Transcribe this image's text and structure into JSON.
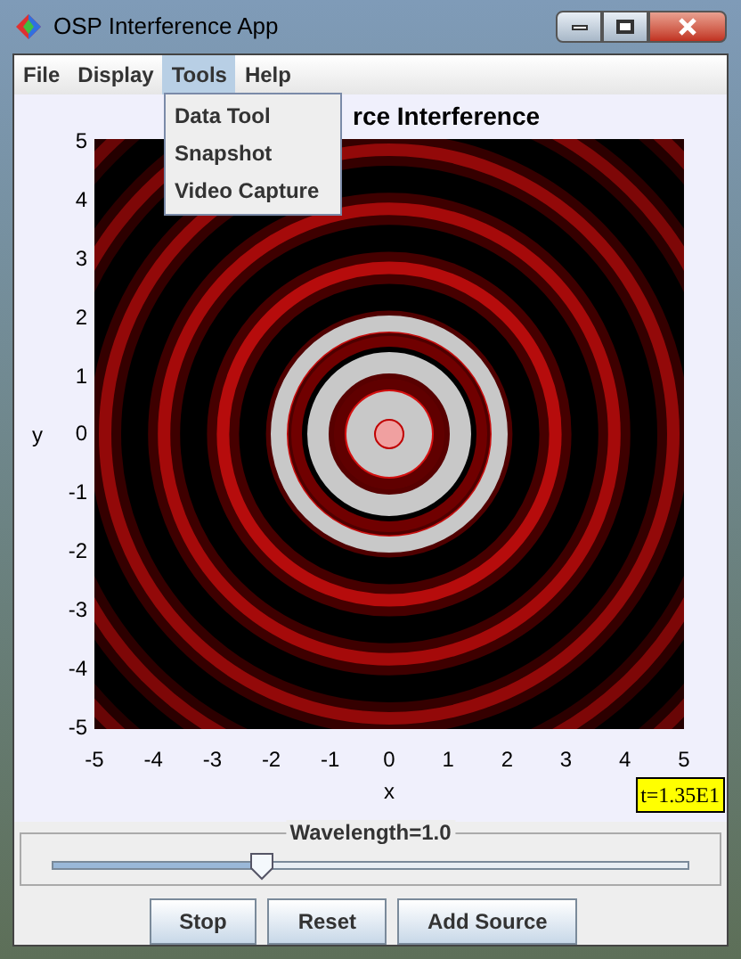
{
  "window": {
    "title": "OSP Interference App"
  },
  "menu": [
    {
      "label": "File",
      "selected": false
    },
    {
      "label": "Display",
      "selected": false
    },
    {
      "label": "Tools",
      "selected": true
    },
    {
      "label": "Help",
      "selected": false
    }
  ],
  "dropdown": [
    "Data Tool",
    "Snapshot",
    "Video Capture"
  ],
  "plot": {
    "title": "rce Interference",
    "xlabel": "x",
    "ylabel": "y",
    "xticks": [
      "-5",
      "-4",
      "-3",
      "-2",
      "-1",
      "0",
      "1",
      "2",
      "3",
      "4",
      "5"
    ],
    "yticks": [
      "5",
      "4",
      "3",
      "2",
      "1",
      "0",
      "-1",
      "-2",
      "-3",
      "-4",
      "-5"
    ],
    "time": "t=1.35E1"
  },
  "slider": {
    "label": "Wavelength=1.0",
    "level": 0.33
  },
  "buttons": [
    "Stop",
    "Reset",
    "Add Source"
  ]
}
